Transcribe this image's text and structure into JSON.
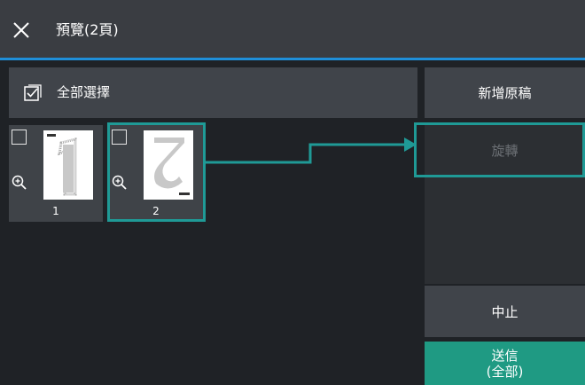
{
  "header": {
    "title": "預覽(2頁)",
    "close_icon": "close-icon"
  },
  "toolbar": {
    "select_all_label": "全部選擇"
  },
  "thumbnails": [
    {
      "number": "1",
      "checked": false
    },
    {
      "number": "2",
      "checked": false
    }
  ],
  "actions": {
    "add_original": "新增原稿",
    "rotate": "旋轉",
    "stop": "中止",
    "send_line1": "送信",
    "send_line2": "(全部)"
  },
  "colors": {
    "accent": "#1f8fd9",
    "highlight": "#1f9a96",
    "send": "#1f9a83"
  }
}
